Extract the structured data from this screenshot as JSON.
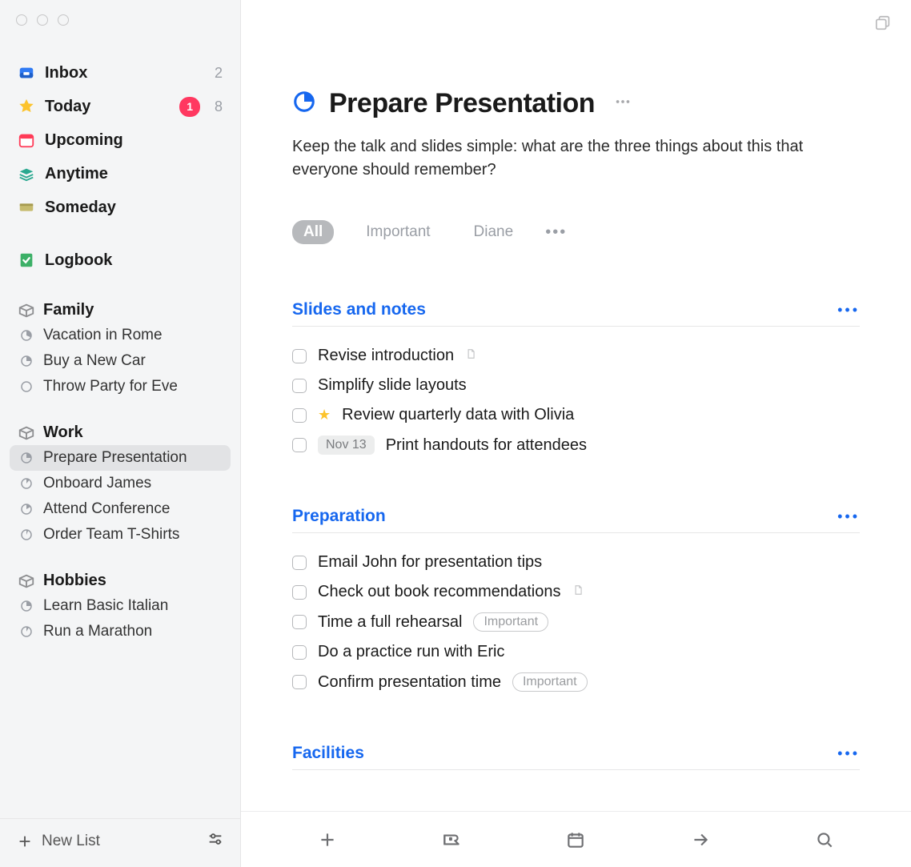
{
  "sidebar": {
    "smart_lists": [
      {
        "name": "inbox",
        "label": "Inbox",
        "count": "2",
        "icon": "inbox",
        "bold": true
      },
      {
        "name": "today",
        "label": "Today",
        "count": "8",
        "badge": "1",
        "icon": "star",
        "bold": true
      },
      {
        "name": "upcoming",
        "label": "Upcoming",
        "icon": "calendar",
        "bold": true
      },
      {
        "name": "anytime",
        "label": "Anytime",
        "icon": "stack",
        "bold": true
      },
      {
        "name": "someday",
        "label": "Someday",
        "icon": "drawer",
        "bold": true
      }
    ],
    "logbook": {
      "label": "Logbook"
    },
    "areas": [
      {
        "name": "family",
        "label": "Family",
        "projects": [
          {
            "name": "vacation-in-rome",
            "label": "Vacation in Rome"
          },
          {
            "name": "buy-a-new-car",
            "label": "Buy a New Car"
          },
          {
            "name": "throw-party-for-eve",
            "label": "Throw Party for Eve"
          }
        ]
      },
      {
        "name": "work",
        "label": "Work",
        "projects": [
          {
            "name": "prepare-presentation",
            "label": "Prepare Presentation",
            "selected": true
          },
          {
            "name": "onboard-james",
            "label": "Onboard James"
          },
          {
            "name": "attend-conference",
            "label": "Attend Conference"
          },
          {
            "name": "order-team-t-shirts",
            "label": "Order Team T-Shirts"
          }
        ]
      },
      {
        "name": "hobbies",
        "label": "Hobbies",
        "projects": [
          {
            "name": "learn-basic-italian",
            "label": "Learn Basic Italian"
          },
          {
            "name": "run-a-marathon",
            "label": "Run a Marathon"
          }
        ]
      }
    ],
    "new_list_label": "New List"
  },
  "project": {
    "title": "Prepare Presentation",
    "notes": "Keep the talk and slides simple: what are the three things about this that everyone should remember?",
    "filters": [
      {
        "label": "All",
        "active": true
      },
      {
        "label": "Important",
        "active": false
      },
      {
        "label": "Diane",
        "active": false
      }
    ],
    "sections": [
      {
        "title": "Slides and notes",
        "tasks": [
          {
            "text": "Revise introduction",
            "has_note": true
          },
          {
            "text": "Simplify slide layouts"
          },
          {
            "text": "Review quarterly data with Olivia",
            "starred": true
          },
          {
            "text": "Print handouts for attendees",
            "date": "Nov 13"
          }
        ]
      },
      {
        "title": "Preparation",
        "tasks": [
          {
            "text": "Email John for presentation tips"
          },
          {
            "text": "Check out book recommendations",
            "has_note": true
          },
          {
            "text": "Time a full rehearsal",
            "tag": "Important"
          },
          {
            "text": "Do a practice run with Eric"
          },
          {
            "text": "Confirm presentation time",
            "tag": "Important"
          }
        ]
      },
      {
        "title": "Facilities",
        "tasks": []
      }
    ]
  }
}
